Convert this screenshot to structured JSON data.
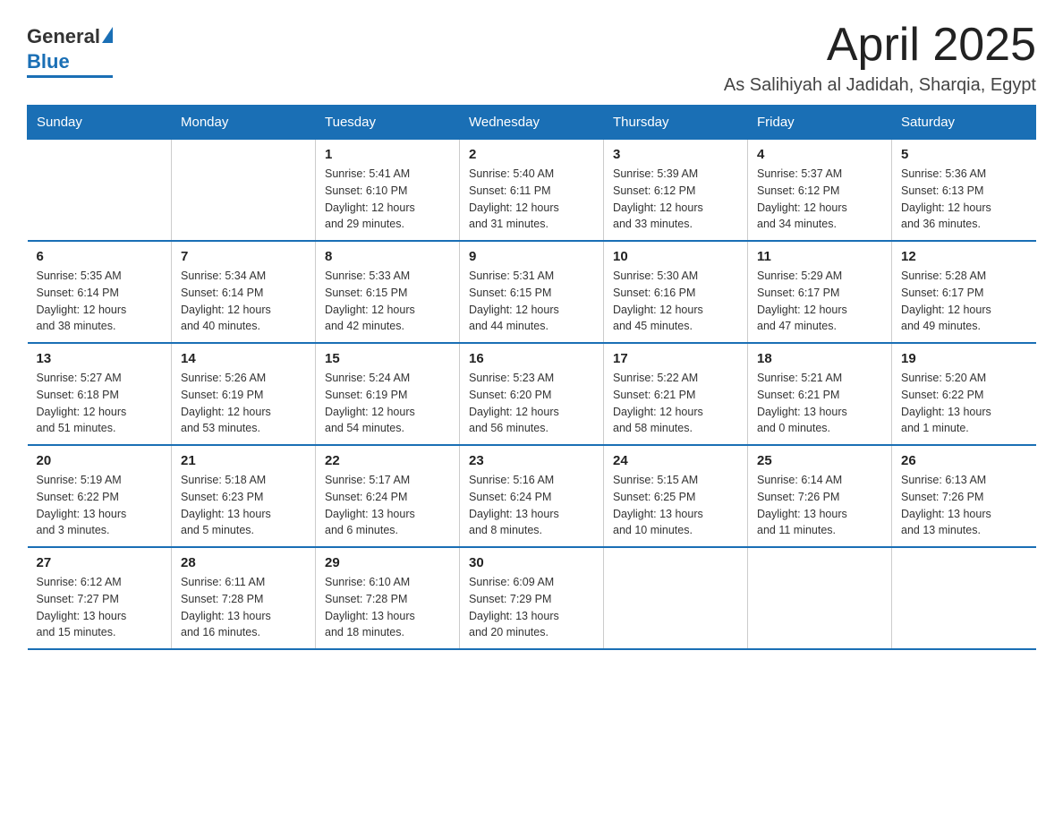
{
  "header": {
    "logo": {
      "general": "General",
      "blue": "Blue"
    },
    "title": "April 2025",
    "location": "As Salihiyah al Jadidah, Sharqia, Egypt"
  },
  "days_of_week": [
    "Sunday",
    "Monday",
    "Tuesday",
    "Wednesday",
    "Thursday",
    "Friday",
    "Saturday"
  ],
  "weeks": [
    [
      {
        "day": "",
        "info": ""
      },
      {
        "day": "",
        "info": ""
      },
      {
        "day": "1",
        "info": "Sunrise: 5:41 AM\nSunset: 6:10 PM\nDaylight: 12 hours\nand 29 minutes."
      },
      {
        "day": "2",
        "info": "Sunrise: 5:40 AM\nSunset: 6:11 PM\nDaylight: 12 hours\nand 31 minutes."
      },
      {
        "day": "3",
        "info": "Sunrise: 5:39 AM\nSunset: 6:12 PM\nDaylight: 12 hours\nand 33 minutes."
      },
      {
        "day": "4",
        "info": "Sunrise: 5:37 AM\nSunset: 6:12 PM\nDaylight: 12 hours\nand 34 minutes."
      },
      {
        "day": "5",
        "info": "Sunrise: 5:36 AM\nSunset: 6:13 PM\nDaylight: 12 hours\nand 36 minutes."
      }
    ],
    [
      {
        "day": "6",
        "info": "Sunrise: 5:35 AM\nSunset: 6:14 PM\nDaylight: 12 hours\nand 38 minutes."
      },
      {
        "day": "7",
        "info": "Sunrise: 5:34 AM\nSunset: 6:14 PM\nDaylight: 12 hours\nand 40 minutes."
      },
      {
        "day": "8",
        "info": "Sunrise: 5:33 AM\nSunset: 6:15 PM\nDaylight: 12 hours\nand 42 minutes."
      },
      {
        "day": "9",
        "info": "Sunrise: 5:31 AM\nSunset: 6:15 PM\nDaylight: 12 hours\nand 44 minutes."
      },
      {
        "day": "10",
        "info": "Sunrise: 5:30 AM\nSunset: 6:16 PM\nDaylight: 12 hours\nand 45 minutes."
      },
      {
        "day": "11",
        "info": "Sunrise: 5:29 AM\nSunset: 6:17 PM\nDaylight: 12 hours\nand 47 minutes."
      },
      {
        "day": "12",
        "info": "Sunrise: 5:28 AM\nSunset: 6:17 PM\nDaylight: 12 hours\nand 49 minutes."
      }
    ],
    [
      {
        "day": "13",
        "info": "Sunrise: 5:27 AM\nSunset: 6:18 PM\nDaylight: 12 hours\nand 51 minutes."
      },
      {
        "day": "14",
        "info": "Sunrise: 5:26 AM\nSunset: 6:19 PM\nDaylight: 12 hours\nand 53 minutes."
      },
      {
        "day": "15",
        "info": "Sunrise: 5:24 AM\nSunset: 6:19 PM\nDaylight: 12 hours\nand 54 minutes."
      },
      {
        "day": "16",
        "info": "Sunrise: 5:23 AM\nSunset: 6:20 PM\nDaylight: 12 hours\nand 56 minutes."
      },
      {
        "day": "17",
        "info": "Sunrise: 5:22 AM\nSunset: 6:21 PM\nDaylight: 12 hours\nand 58 minutes."
      },
      {
        "day": "18",
        "info": "Sunrise: 5:21 AM\nSunset: 6:21 PM\nDaylight: 13 hours\nand 0 minutes."
      },
      {
        "day": "19",
        "info": "Sunrise: 5:20 AM\nSunset: 6:22 PM\nDaylight: 13 hours\nand 1 minute."
      }
    ],
    [
      {
        "day": "20",
        "info": "Sunrise: 5:19 AM\nSunset: 6:22 PM\nDaylight: 13 hours\nand 3 minutes."
      },
      {
        "day": "21",
        "info": "Sunrise: 5:18 AM\nSunset: 6:23 PM\nDaylight: 13 hours\nand 5 minutes."
      },
      {
        "day": "22",
        "info": "Sunrise: 5:17 AM\nSunset: 6:24 PM\nDaylight: 13 hours\nand 6 minutes."
      },
      {
        "day": "23",
        "info": "Sunrise: 5:16 AM\nSunset: 6:24 PM\nDaylight: 13 hours\nand 8 minutes."
      },
      {
        "day": "24",
        "info": "Sunrise: 5:15 AM\nSunset: 6:25 PM\nDaylight: 13 hours\nand 10 minutes."
      },
      {
        "day": "25",
        "info": "Sunrise: 6:14 AM\nSunset: 7:26 PM\nDaylight: 13 hours\nand 11 minutes."
      },
      {
        "day": "26",
        "info": "Sunrise: 6:13 AM\nSunset: 7:26 PM\nDaylight: 13 hours\nand 13 minutes."
      }
    ],
    [
      {
        "day": "27",
        "info": "Sunrise: 6:12 AM\nSunset: 7:27 PM\nDaylight: 13 hours\nand 15 minutes."
      },
      {
        "day": "28",
        "info": "Sunrise: 6:11 AM\nSunset: 7:28 PM\nDaylight: 13 hours\nand 16 minutes."
      },
      {
        "day": "29",
        "info": "Sunrise: 6:10 AM\nSunset: 7:28 PM\nDaylight: 13 hours\nand 18 minutes."
      },
      {
        "day": "30",
        "info": "Sunrise: 6:09 AM\nSunset: 7:29 PM\nDaylight: 13 hours\nand 20 minutes."
      },
      {
        "day": "",
        "info": ""
      },
      {
        "day": "",
        "info": ""
      },
      {
        "day": "",
        "info": ""
      }
    ]
  ]
}
